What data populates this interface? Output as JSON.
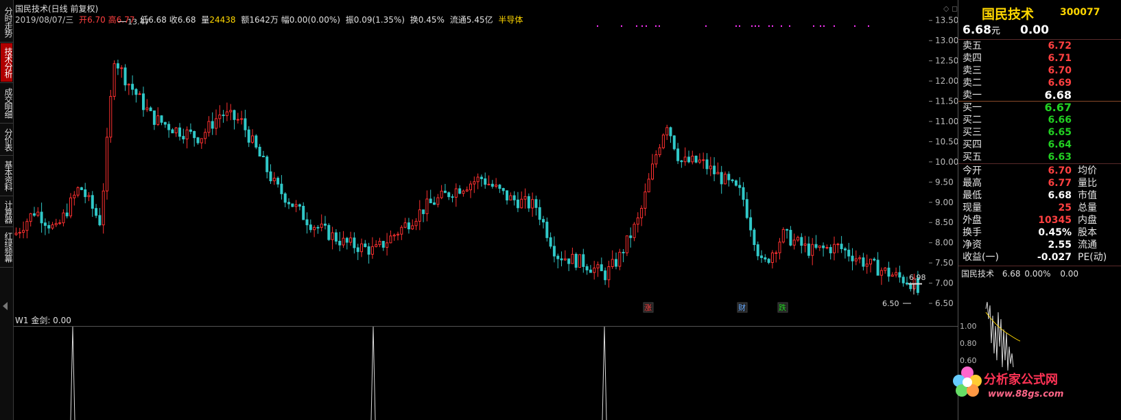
{
  "left_tabs": [
    {
      "label": "分时走势",
      "active": false
    },
    {
      "label": "技术分析",
      "active": true
    },
    {
      "label": "成交明细",
      "active": false
    },
    {
      "label": "分价表",
      "active": false
    },
    {
      "label": "基本资料",
      "active": false
    },
    {
      "label": "计算器",
      "active": false
    },
    {
      "label": "红绿频幕",
      "active": false
    }
  ],
  "header": {
    "title": "国民技术(日线 前复权)",
    "date": "2019/08/07/三",
    "open_label": "开",
    "open": "6.70",
    "high_label": "高",
    "high": "6.77",
    "low_label": "低",
    "low": "6.68",
    "close_label": "收",
    "close": "6.68",
    "volume_label": "量",
    "volume": "24438",
    "amount": "额1642万",
    "change": "幅0.00(0.00%)",
    "amplitude": "振0.09(1.35%)",
    "turnover": "换0.45%",
    "float_cap": "流通5.45亿",
    "sector": "半导体"
  },
  "main_chart": {
    "price_axis": [
      "13.50",
      "13.00",
      "12.50",
      "12.00",
      "11.50",
      "11.00",
      "10.50",
      "10.00",
      "9.50",
      "9.00",
      "8.50",
      "8.00",
      "7.50",
      "7.00",
      "6.50"
    ],
    "high_marker": "13.47",
    "low_marker": "6.50",
    "last_marker": "6.98",
    "event_markers": [
      {
        "text": "涨",
        "color": "#ff4040"
      },
      {
        "text": "财",
        "color": "#66aaff"
      },
      {
        "text": "跌",
        "color": "#22d022"
      }
    ],
    "colors": {
      "up": "#ff3030",
      "down": "#30c8c8",
      "axis": "#888888"
    }
  },
  "sub_chart": {
    "title": "W1 金剑: 0.00",
    "axis": []
  },
  "quote_panel": {
    "name": "国民技术",
    "code": "300077",
    "price": "6.68",
    "price_unit": "元",
    "change": "0.00",
    "sell": [
      {
        "label": "卖五",
        "price": "6.72"
      },
      {
        "label": "卖四",
        "price": "6.71"
      },
      {
        "label": "卖三",
        "price": "6.70"
      },
      {
        "label": "卖二",
        "price": "6.69"
      },
      {
        "label": "卖一",
        "price": "6.68"
      }
    ],
    "buy": [
      {
        "label": "买一",
        "price": "6.67"
      },
      {
        "label": "买二",
        "price": "6.66"
      },
      {
        "label": "买三",
        "price": "6.65"
      },
      {
        "label": "买四",
        "price": "6.64"
      },
      {
        "label": "买五",
        "price": "6.63"
      }
    ],
    "stats": [
      {
        "label": "今开",
        "value": "6.70",
        "color": "red",
        "label2": "均价"
      },
      {
        "label": "最高",
        "value": "6.77",
        "color": "red",
        "label2": "量比"
      },
      {
        "label": "最低",
        "value": "6.68",
        "color": "white",
        "label2": "市值"
      },
      {
        "label": "现量",
        "value": "25",
        "color": "red",
        "label2": "总量"
      },
      {
        "label": "外盘",
        "value": "10345",
        "color": "red",
        "label2": "内盘"
      },
      {
        "label": "换手",
        "value": "0.45%",
        "color": "white",
        "label2": "股本"
      },
      {
        "label": "净资",
        "value": "2.55",
        "color": "white",
        "label2": "流通"
      },
      {
        "label": "收益(一)",
        "value": "-0.027",
        "color": "white",
        "label2": "PE(动)"
      }
    ],
    "mini_title": "国民技术",
    "mini_price": "6.68",
    "mini_change": "0.00%",
    "mini_amount": "0.00",
    "mini_axis": [
      "1.00",
      "0.80",
      "0.60"
    ]
  },
  "watermark": {
    "text": "分析家公式网",
    "url": "www.88gs.com"
  }
}
